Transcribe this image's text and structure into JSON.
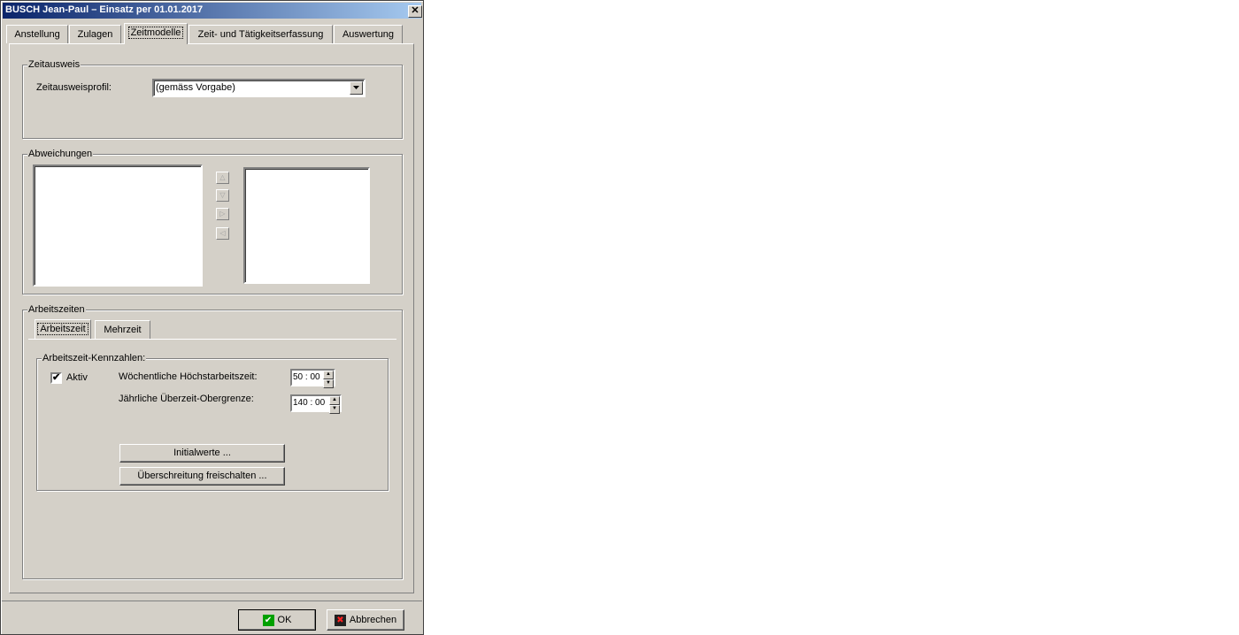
{
  "window": {
    "title": "BUSCH Jean-Paul  –  Einsatz per 01.01.2017",
    "close_glyph": "✕"
  },
  "tabs": [
    {
      "label": "Anstellung"
    },
    {
      "label": "Zulagen"
    },
    {
      "label": "Zeitmodelle"
    },
    {
      "label": "Zeit- und Tätigkeitserfassung"
    },
    {
      "label": "Auswertung"
    }
  ],
  "zeitausweis": {
    "group_label": "Zeitausweis",
    "profile_label": "Zeitausweisprofil:",
    "profile_value": "(gemäss Vorgabe)"
  },
  "abweichungen": {
    "group_label": "Abweichungen",
    "buttons": {
      "up": "△",
      "down": "▽",
      "right": "▷",
      "left": "◁"
    }
  },
  "arbeitszeiten": {
    "group_label": "Arbeitszeiten",
    "subtabs": [
      {
        "label": "Arbeitszeit"
      },
      {
        "label": "Mehrzeit"
      }
    ],
    "kennzahlen": {
      "group_label": "Arbeitszeit-Kennzahlen:",
      "aktiv_label": "Aktiv",
      "aktiv_checked": true,
      "check_glyph": "✔",
      "weekly_label": "Wöchentliche Höchstarbeitszeit:",
      "weekly_value": "50 : 00",
      "yearly_label": "Jährliche Überzeit-Obergrenze:",
      "yearly_value": "140 : 00",
      "spin_up": "▲",
      "spin_down": "▼",
      "initialwerte_label": "Initialwerte ...",
      "freischalten_label": "Überschreitung freischalten ..."
    }
  },
  "footer": {
    "ok_label": "OK",
    "cancel_label": "Abbrechen",
    "ok_icon_glyph": "✔",
    "cancel_icon_glyph": "✖",
    "ok_icon_color": "#00a000",
    "cancel_icon_color": "#c00000"
  }
}
